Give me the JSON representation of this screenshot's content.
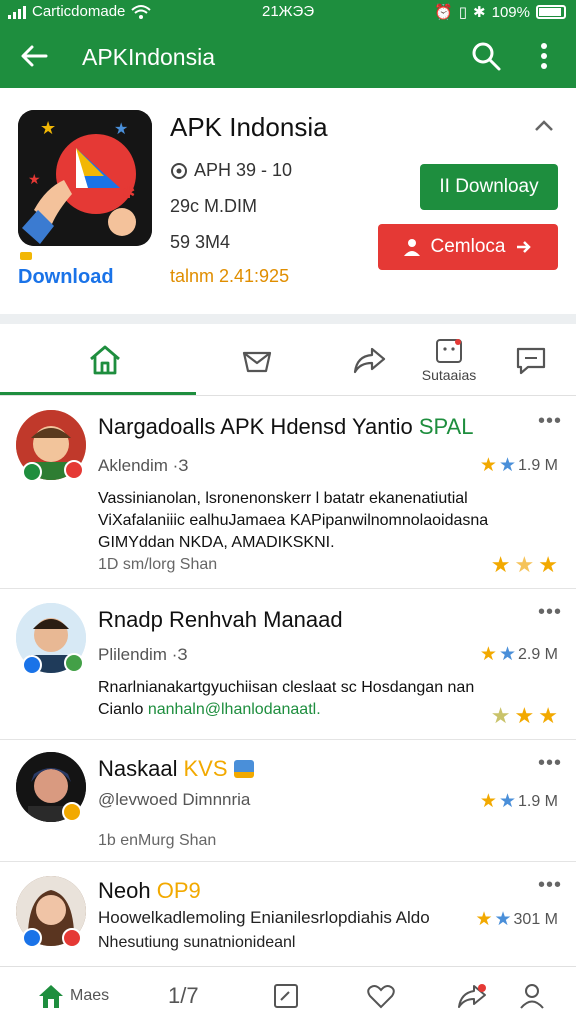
{
  "status": {
    "carrier": "Carticdomade",
    "time": "21ЖЭЭ",
    "battery": "109%"
  },
  "appbar": {
    "title": "APKIndonsia"
  },
  "app": {
    "name": "APK Indonsia",
    "version": "APH 39 - 10",
    "downloads": "29c M.DIM",
    "size": "59 3M4",
    "date": "talnm 2.41:925",
    "download_link": "Download",
    "primary_button": "II Downloay",
    "secondary_button": "Cemloca"
  },
  "tabs": [
    {
      "label": ""
    },
    {
      "label": ""
    },
    {
      "label": ""
    },
    {
      "label": "Sutaaias"
    },
    {
      "label": ""
    }
  ],
  "colors": {
    "brand": "#1e8e3e",
    "danger": "#e53935",
    "star": "#f2a900",
    "star_blue": "#4a8fd9"
  },
  "reviews": [
    {
      "name": "Nargadoalls APK Hdensd Yantio ",
      "name_accent": "SPAL",
      "sub": "Aklendim ·З",
      "rating": "1.9 M",
      "body": "Vassinianolan, lsronenonskerr l batatr ekanenatiutial ViXafalaniiic ealhuJamaea KAPipanwilnomnolaoidasna GIMYddan NKDA, AMADIKSKNI.",
      "foot": "1D sm/lorg Shan"
    },
    {
      "name": "Rnadp Renhvah Manaad",
      "sub": "Plilendim ·З",
      "rating": "2.9 M",
      "body": "Rnarlnianakartgyuchiisan cleslaat sc Hosdangan nan Cianlo ",
      "body_accent": "nanhaln@lhanlodanaatl.",
      "foot": ""
    },
    {
      "name": "Naskaal",
      "name_accent": "KVS",
      "sub": "@levwoed Dimnnria",
      "rating": "1.9 M",
      "body": "",
      "foot": "1b enMurg Shan"
    },
    {
      "name": "Neoh ",
      "name_accent": "OP9",
      "sub": "Hoowelkadlemoling Enianilesrlopdiahis Aldo",
      "rating": "301 M",
      "body": "",
      "foot": "Nhesutiung sunatnionideanl"
    }
  ],
  "bottom_nav": [
    {
      "label": "Maes"
    },
    {
      "label": "1/7"
    },
    {
      "label": ""
    },
    {
      "label": ""
    },
    {
      "label": ""
    },
    {
      "label": ""
    }
  ]
}
